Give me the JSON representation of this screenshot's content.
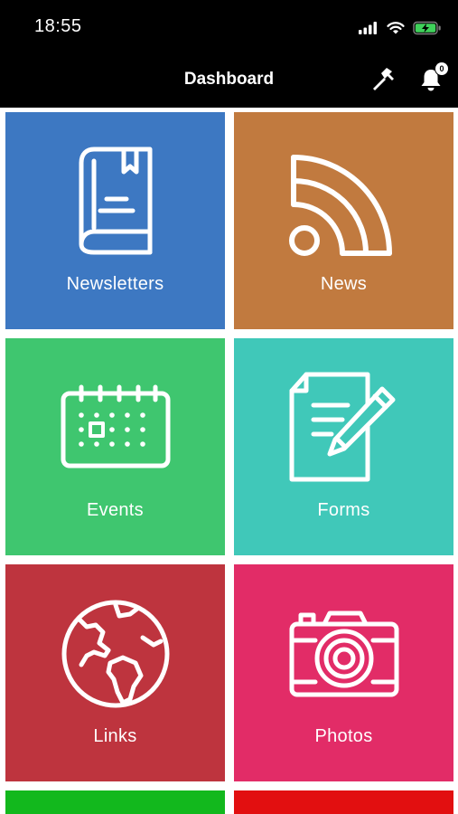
{
  "status_bar": {
    "time": "18:55"
  },
  "header": {
    "title": "Dashboard",
    "notification_count": "0",
    "left_action_icon": "hammer-icon",
    "right_action_icon": "bell-icon"
  },
  "tiles": [
    {
      "label": "Newsletters",
      "icon": "book-icon",
      "color": "#3D78C2"
    },
    {
      "label": "News",
      "icon": "rss-icon",
      "color": "#C17A3F"
    },
    {
      "label": "Events",
      "icon": "calendar-icon",
      "color": "#3FC66F"
    },
    {
      "label": "Forms",
      "icon": "form-pencil-icon",
      "color": "#40C8B9"
    },
    {
      "label": "Links",
      "icon": "globe-icon",
      "color": "#BE343E"
    },
    {
      "label": "Photos",
      "icon": "camera-icon",
      "color": "#E22C67"
    },
    {
      "label": "",
      "icon": "",
      "color": "#12B81D"
    },
    {
      "label": "",
      "icon": "",
      "color": "#E20F10"
    }
  ]
}
